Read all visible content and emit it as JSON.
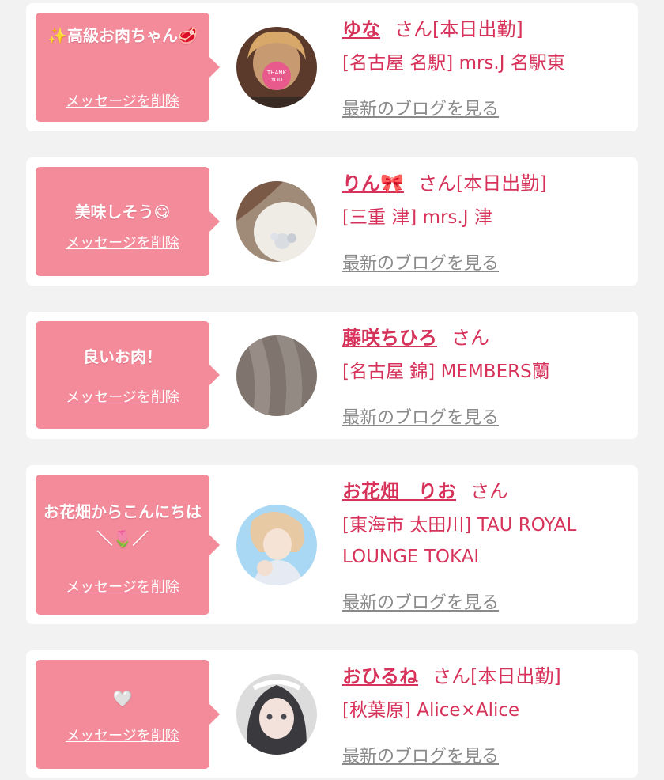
{
  "accent_color": "#d6325a",
  "bubble_color": "#f48b9b",
  "messages": [
    {
      "bubble_text": "✨高級お肉ちゃん🥩",
      "delete_label": "メッセージを削除",
      "name": "ゆな",
      "san": "さん[本日出勤]",
      "shop": "[名古屋 名駅] mrs.J 名駅東",
      "blog": "最新のブログを見る",
      "avatar_icon": "avatar-thank-you-mask"
    },
    {
      "bubble_text": "美味しそう😋",
      "delete_label": "メッセージを削除",
      "name": "りん🎀",
      "san": "さん[本日出勤]",
      "shop": "[三重 津] mrs.J 津",
      "blog": "最新のブログを見る",
      "avatar_icon": "avatar-lace"
    },
    {
      "bubble_text": "良いお肉！",
      "delete_label": "メッセージを削除",
      "name": "藤咲ちひろ",
      "san": "さん",
      "shop": "[名古屋 錦] MEMBERS蘭",
      "blog": "最新のブログを見る",
      "avatar_icon": "avatar-hair"
    },
    {
      "bubble_text": "お花畑からこんにちは＼🌷／",
      "delete_label": "メッセージを削除",
      "name": "お花畑　りお",
      "san": "さん",
      "shop": "[東海市 太田川] TAU ROYAL LOUNGE TOKAI",
      "blog": "最新のブログを見る",
      "avatar_icon": "avatar-portrait"
    },
    {
      "bubble_text": "🤍",
      "delete_label": "メッセージを削除",
      "name": "おひるね",
      "san": "さん[本日出勤]",
      "shop": "[秋葉原] Alice×Alice",
      "blog": "最新のブログを見る",
      "avatar_icon": "avatar-maid"
    }
  ]
}
